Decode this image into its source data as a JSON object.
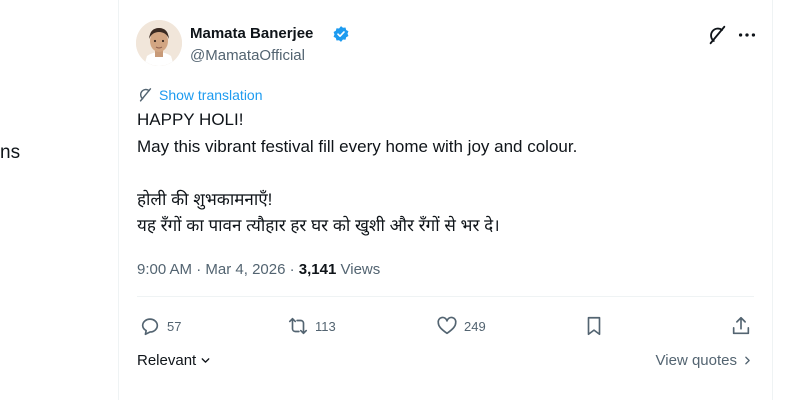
{
  "left_nav": {
    "fragment_text": "ns"
  },
  "post": {
    "author": {
      "name": "Mamata Banerjee",
      "handle": "@MamataOfficial",
      "verified": true
    },
    "translate_label": "Show translation",
    "lines": [
      "HAPPY HOLI!",
      "May this vibrant festival fill every home with joy and colour.",
      "होली की शुभकामनाएँ!",
      "यह रँगों का पावन त्यौहार हर घर को खुशी और रँगों से भर दे।"
    ],
    "meta": {
      "time": "9:00 AM",
      "date": "Mar 4, 2026",
      "views_count": "3,141",
      "views_label": "Views"
    },
    "actions": {
      "replies": "57",
      "reposts": "113",
      "likes": "249"
    },
    "footer": {
      "sort_label": "Relevant",
      "view_quotes_label": "View quotes"
    }
  },
  "colors": {
    "accent": "#1d9bf0",
    "text": "#0f1419",
    "muted": "#536471",
    "divider": "#eff3f4"
  },
  "icons": [
    "verified-badge-icon",
    "grok-icon",
    "more-icon",
    "translate-icon",
    "reply-icon",
    "repost-icon",
    "like-icon",
    "bookmark-icon",
    "share-icon",
    "chevron-down-icon",
    "chevron-right-icon"
  ]
}
